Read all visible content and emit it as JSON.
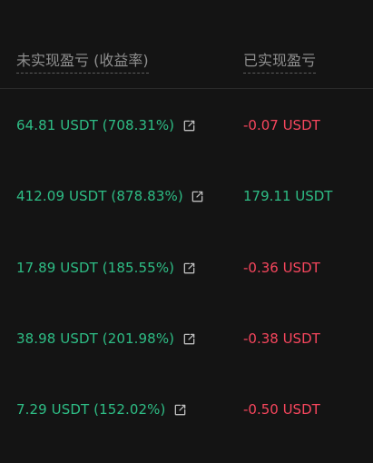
{
  "header": {
    "unrealized_label": "未实现盈亏 (收益率)",
    "realized_label": "已实现盈亏"
  },
  "rows": [
    {
      "unrealized": "64.81 USDT (708.31%)",
      "realized": "-0.07 USDT",
      "realized_sign": "negative"
    },
    {
      "unrealized": "412.09 USDT (878.83%)",
      "realized": "179.11 USDT",
      "realized_sign": "positive"
    },
    {
      "unrealized": "17.89 USDT (185.55%)",
      "realized": "-0.36 USDT",
      "realized_sign": "negative"
    },
    {
      "unrealized": "38.98 USDT (201.98%)",
      "realized": "-0.38 USDT",
      "realized_sign": "negative"
    },
    {
      "unrealized": "7.29 USDT (152.02%)",
      "realized": "-0.50 USDT",
      "realized_sign": "negative"
    }
  ],
  "icons": {
    "share": "external-link-icon"
  },
  "colors": {
    "background": "#141414",
    "positive": "#2ebd85",
    "negative": "#f6465d",
    "header_text": "#8f8f8f"
  }
}
